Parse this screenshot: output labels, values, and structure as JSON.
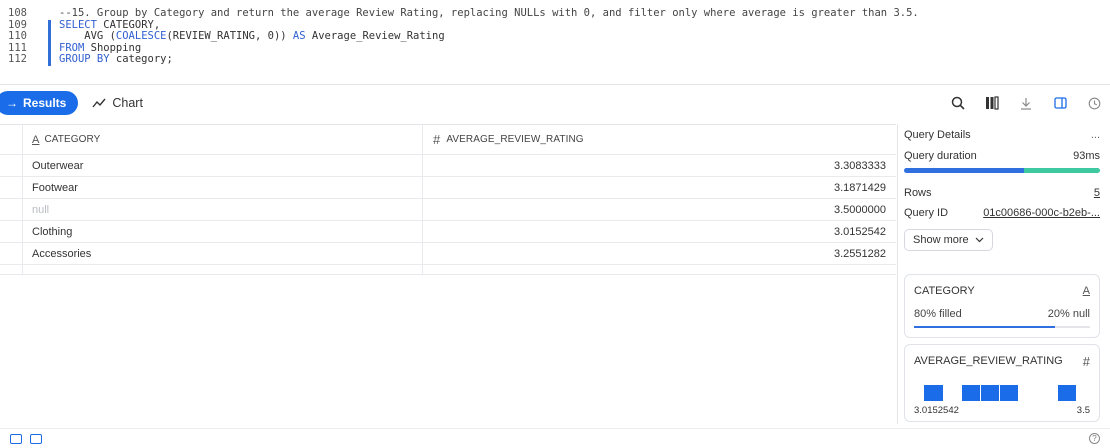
{
  "editor": {
    "lines": [
      {
        "num": "108",
        "parts": [
          {
            "t": "--15. Group by Category and return the average Review Rating, replacing NULLs with 0, and filter only where average is greater than 3.5.",
            "c": "cmt"
          }
        ]
      },
      {
        "num": "109",
        "parts": [
          {
            "t": "SELECT",
            "c": "kw"
          },
          {
            "t": " CATEGORY,",
            "c": ""
          }
        ]
      },
      {
        "num": "110",
        "parts": [
          {
            "t": "    AVG (",
            "c": ""
          },
          {
            "t": "COALESCE",
            "c": "kw"
          },
          {
            "t": "(REVIEW_RATING, 0)) ",
            "c": ""
          },
          {
            "t": "AS",
            "c": "kw"
          },
          {
            "t": " Average_Review_Rating",
            "c": ""
          }
        ]
      },
      {
        "num": "111",
        "parts": [
          {
            "t": "FROM",
            "c": "kw"
          },
          {
            "t": " Shopping",
            "c": ""
          }
        ]
      },
      {
        "num": "112",
        "parts": [
          {
            "t": "GROUP BY",
            "c": "kw"
          },
          {
            "t": " category;",
            "c": ""
          }
        ]
      }
    ]
  },
  "toolbar": {
    "results_label": "Results",
    "chart_label": "Chart"
  },
  "table": {
    "columns": [
      {
        "type_icon": "A",
        "name": "CATEGORY"
      },
      {
        "type_icon": "#",
        "name": "AVERAGE_REVIEW_RATING"
      }
    ],
    "rows": [
      {
        "category": "Outerwear",
        "avg": "3.3083333",
        "null": false
      },
      {
        "category": "Footwear",
        "avg": "3.1871429",
        "null": false
      },
      {
        "category": "null",
        "avg": "3.5000000",
        "null": true
      },
      {
        "category": "Clothing",
        "avg": "3.0152542",
        "null": false
      },
      {
        "category": "Accessories",
        "avg": "3.2551282",
        "null": false
      }
    ]
  },
  "panel": {
    "title": "Query Details",
    "more": "...",
    "duration_label": "Query duration",
    "duration_value": "93ms",
    "rows_label": "Rows",
    "rows_value": "5",
    "query_id_label": "Query ID",
    "query_id_value": "01c00686-000c-b2eb-...",
    "show_more": "Show more",
    "category_card": {
      "name": "CATEGORY",
      "type_icon": "A",
      "filled": "80% filled",
      "null": "20% null",
      "filled_fraction": 0.8
    },
    "avg_card": {
      "name": "AVERAGE_REVIEW_RATING",
      "type_icon": "#",
      "min": "3.0152542",
      "max": "3.5"
    }
  }
}
